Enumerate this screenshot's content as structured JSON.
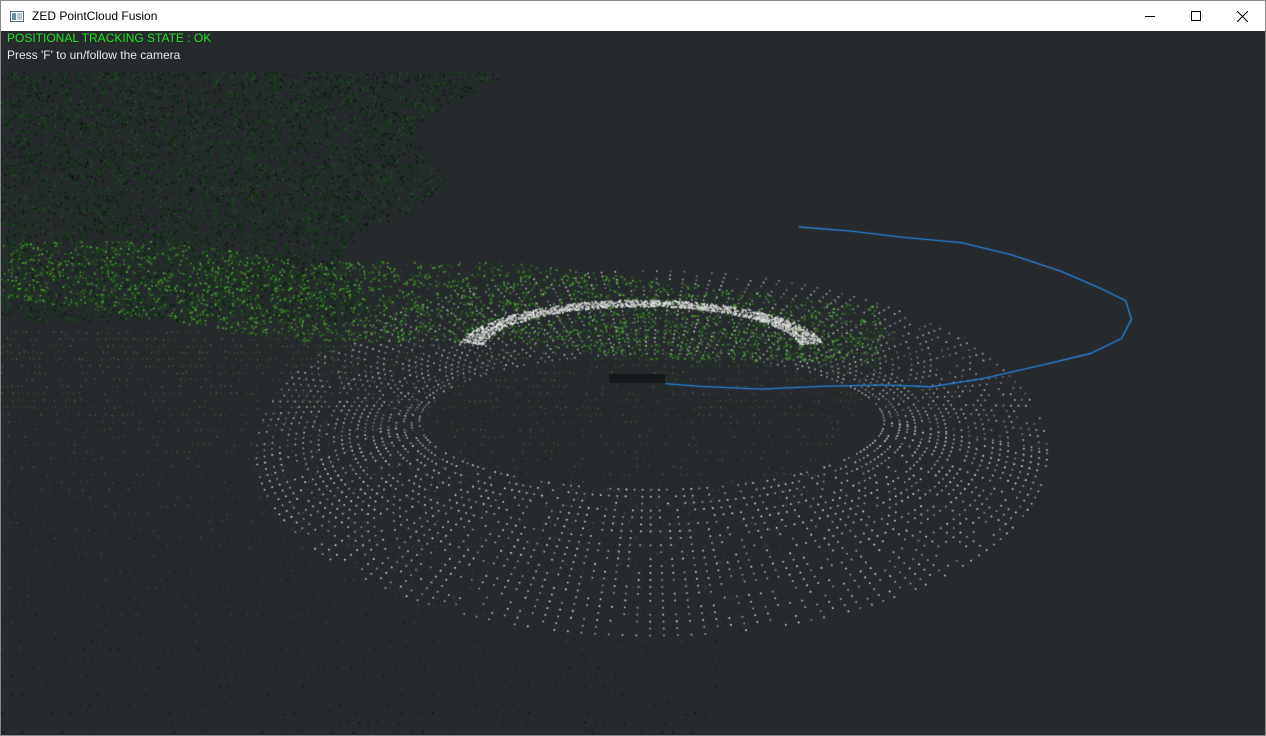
{
  "window": {
    "title": "ZED PointCloud Fusion",
    "controls": {
      "minimize_icon": "minimize-icon",
      "maximize_icon": "maximize-icon",
      "close_icon": "close-icon"
    }
  },
  "viewport": {
    "tracking_status": "POSITIONAL TRACKING STATE : OK",
    "tracking_status_color": "#22e022",
    "hint": "Press 'F' to un/follow the camera",
    "hint_color": "#e6e6e6",
    "background_color": "#262a2d",
    "trajectory_color": "#2a7fd4"
  }
}
